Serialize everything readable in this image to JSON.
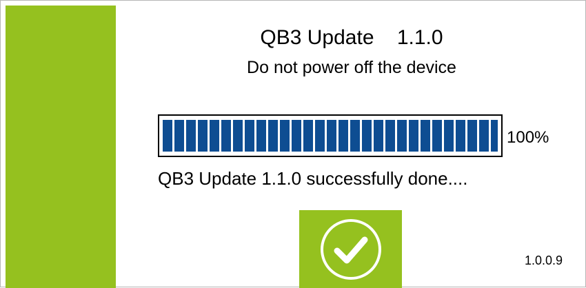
{
  "header": {
    "title": "QB3 Update    1.1.0",
    "warning": "Do not power off the device"
  },
  "progress": {
    "value": 1.0,
    "label": "100%",
    "color": "#0e4d92"
  },
  "status": {
    "message": "QB3 Update 1.1.0 successfully done...."
  },
  "confirm": {
    "icon": "check-circle-icon",
    "color": "#95c11f"
  },
  "footer": {
    "version": "1.0.0.9"
  },
  "colors": {
    "accent": "#95c11f",
    "progress": "#0e4d92",
    "background": "#ffffff"
  }
}
